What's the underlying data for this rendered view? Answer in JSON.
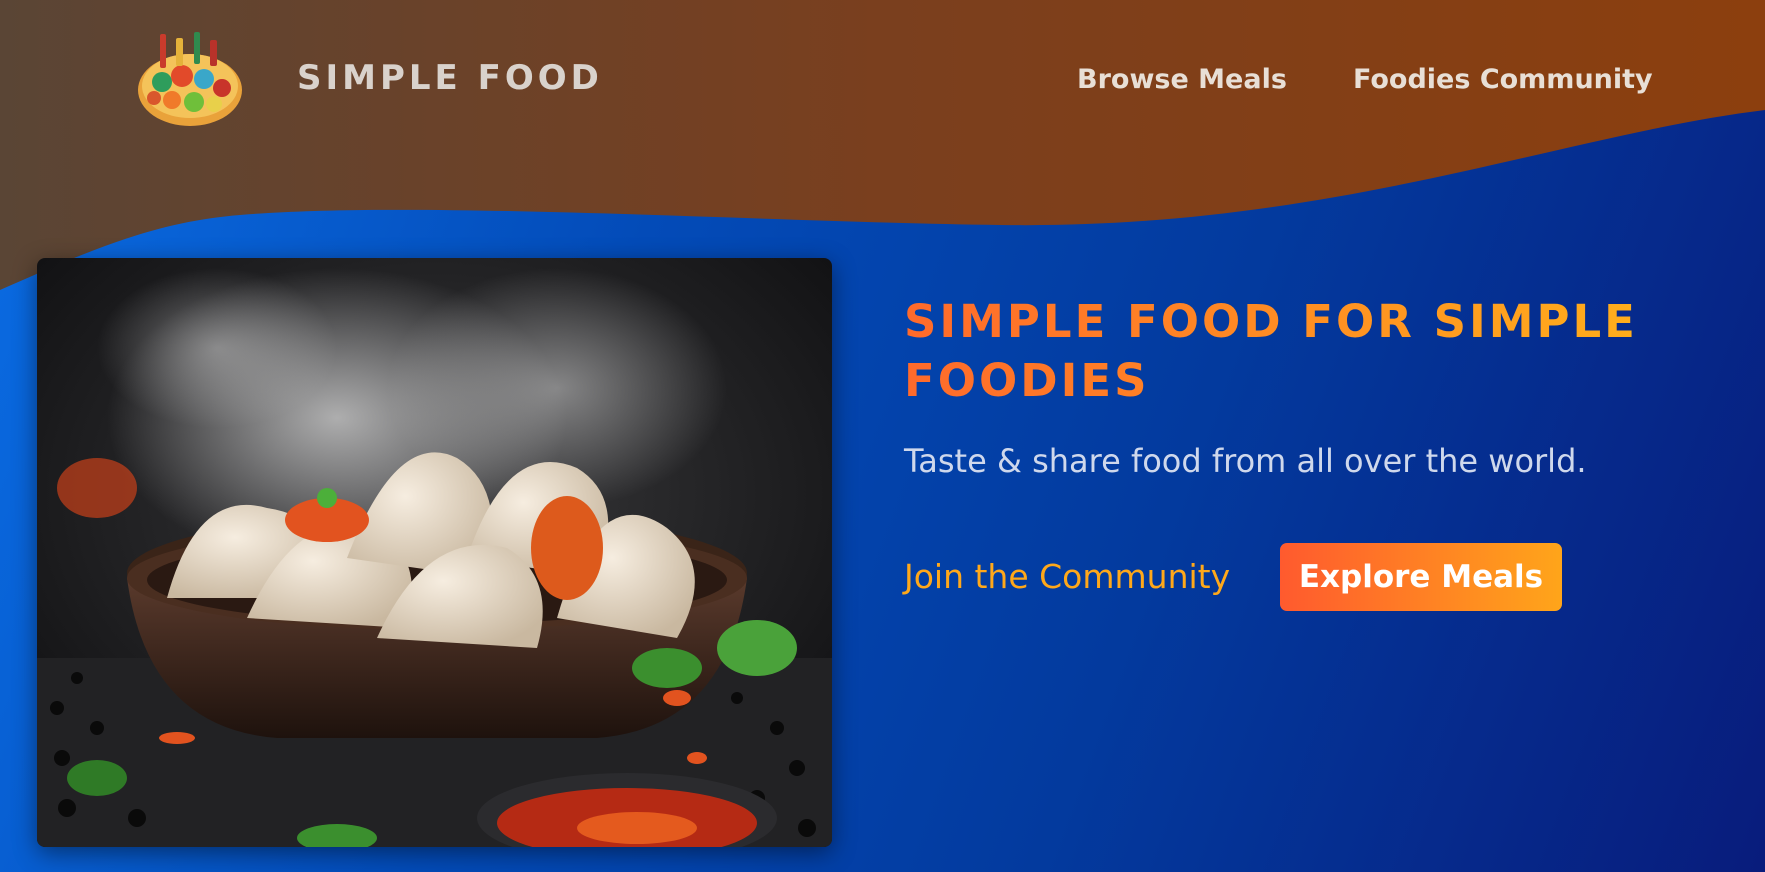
{
  "header": {
    "brand": "SIMPLE FOOD",
    "logo_icon": "food-platter-logo",
    "nav": {
      "browse_meals": "Browse Meals",
      "foodies_community": "Foodies Community"
    }
  },
  "hero": {
    "image_icon": "steaming-dumplings-photo",
    "title": "SIMPLE FOOD FOR SIMPLE FOODIES",
    "subtitle": "Taste & share food from all over the world.",
    "join_link": "Join the Community",
    "explore_button": "Explore Meals"
  },
  "colors": {
    "header_brown": "#5a4535",
    "header_orange": "#8a3d10",
    "hero_blue": "#0b6ee6",
    "hero_navy": "#081c7c",
    "accent_orange": "#ff5a2e",
    "accent_amber": "#ffa51a"
  }
}
